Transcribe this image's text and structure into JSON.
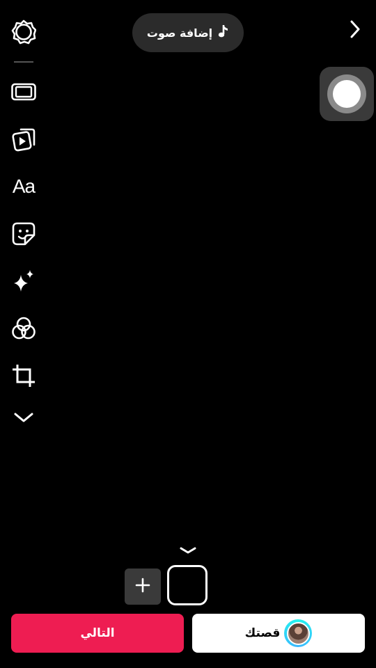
{
  "top_bar": {
    "add_sound_label": "إضافة صوت",
    "music_icon": "music-note-icon",
    "next_icon": "chevron-right-icon"
  },
  "sidebar": {
    "items": [
      {
        "name": "settings",
        "icon": "gear-icon"
      },
      {
        "name": "template",
        "icon": "template-frame-icon"
      },
      {
        "name": "video-clips",
        "icon": "video-clips-icon"
      },
      {
        "name": "text",
        "icon": "text-icon",
        "glyph": "Aa"
      },
      {
        "name": "stickers",
        "icon": "sticker-icon"
      },
      {
        "name": "effects",
        "icon": "sparkles-icon"
      },
      {
        "name": "filters",
        "icon": "filters-icon"
      },
      {
        "name": "crop",
        "icon": "crop-icon"
      },
      {
        "name": "more",
        "icon": "chevron-down-icon"
      }
    ]
  },
  "assistive_touch": {
    "icon": "assistive-touch-icon"
  },
  "clips": {
    "add_label": "+",
    "collapse_icon": "chevron-down-icon"
  },
  "bottom": {
    "story_label": "قصتك",
    "next_label": "التالي"
  },
  "colors": {
    "background": "#000000",
    "accent": "#ee1d52",
    "pill": "#2b2b2b",
    "story_ring": "#25f4ee"
  }
}
